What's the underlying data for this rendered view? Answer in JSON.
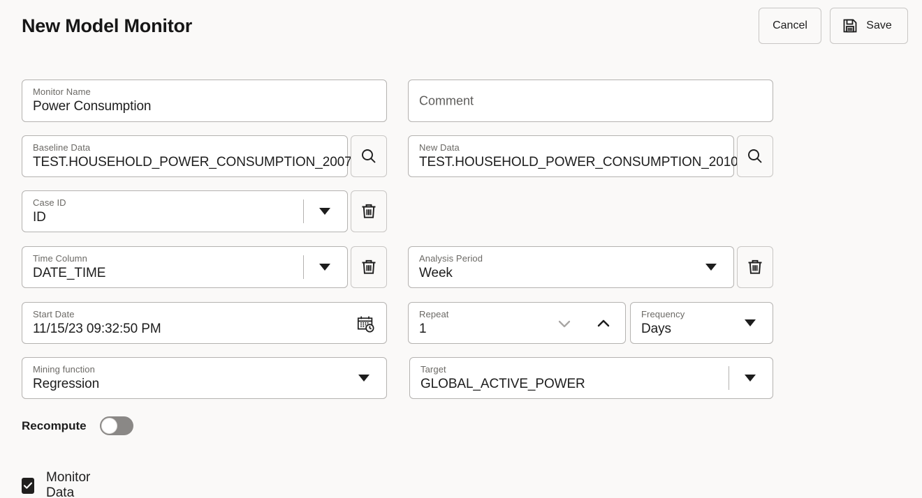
{
  "header": {
    "title": "New Model Monitor",
    "cancel_label": "Cancel",
    "save_label": "Save",
    "save_icon": "floppy-disk-save-icon"
  },
  "form": {
    "monitor_name": {
      "label": "Monitor Name",
      "value": "Power Consumption"
    },
    "comment": {
      "placeholder": "Comment",
      "value": ""
    },
    "baseline_data": {
      "label": "Baseline Data",
      "value": "TEST.HOUSEHOLD_POWER_CONSUMPTION_2007",
      "button_icon": "search-icon"
    },
    "new_data": {
      "label": "New Data",
      "value": "TEST.HOUSEHOLD_POWER_CONSUMPTION_2010",
      "button_icon": "search-icon"
    },
    "case_id": {
      "label": "Case ID",
      "value": "ID",
      "caret_icon": "chevron-down-icon",
      "delete_icon": "trash-icon"
    },
    "time_column": {
      "label": "Time Column",
      "value": "DATE_TIME",
      "caret_icon": "chevron-down-icon",
      "delete_icon": "trash-icon"
    },
    "analysis_period": {
      "label": "Analysis Period",
      "value": "Week",
      "caret_icon": "chevron-down-icon",
      "delete_icon": "trash-icon"
    },
    "start_date": {
      "label": "Start Date",
      "value": "11/15/23 09:32:50 PM",
      "icon": "calendar-clock-icon"
    },
    "repeat": {
      "label": "Repeat",
      "value": "1",
      "decrement_icon": "chevron-down-icon",
      "increment_icon": "chevron-up-icon"
    },
    "frequency": {
      "label": "Frequency",
      "value": "Days",
      "caret_icon": "chevron-down-icon"
    },
    "mining_function": {
      "label": "Mining function",
      "value": "Regression",
      "caret_icon": "chevron-down-icon"
    },
    "target": {
      "label": "Target",
      "value": "GLOBAL_ACTIVE_POWER",
      "caret_icon": "chevron-down-icon"
    },
    "recompute": {
      "label": "Recompute",
      "state": "off"
    },
    "monitor_data": {
      "label": "Monitor Data",
      "state": "checked"
    }
  },
  "colors": {
    "background": "#faf9f8",
    "field_background": "#ffffff",
    "field_border": "#b4b2b0",
    "button_border": "#c8c6c4",
    "text": "#1d1d1d",
    "label_text": "#6b6965",
    "toggle_off_track": "#8a8886",
    "checkbox_checked": "#201f1e",
    "disabled_icon": "#a8a6a4"
  }
}
